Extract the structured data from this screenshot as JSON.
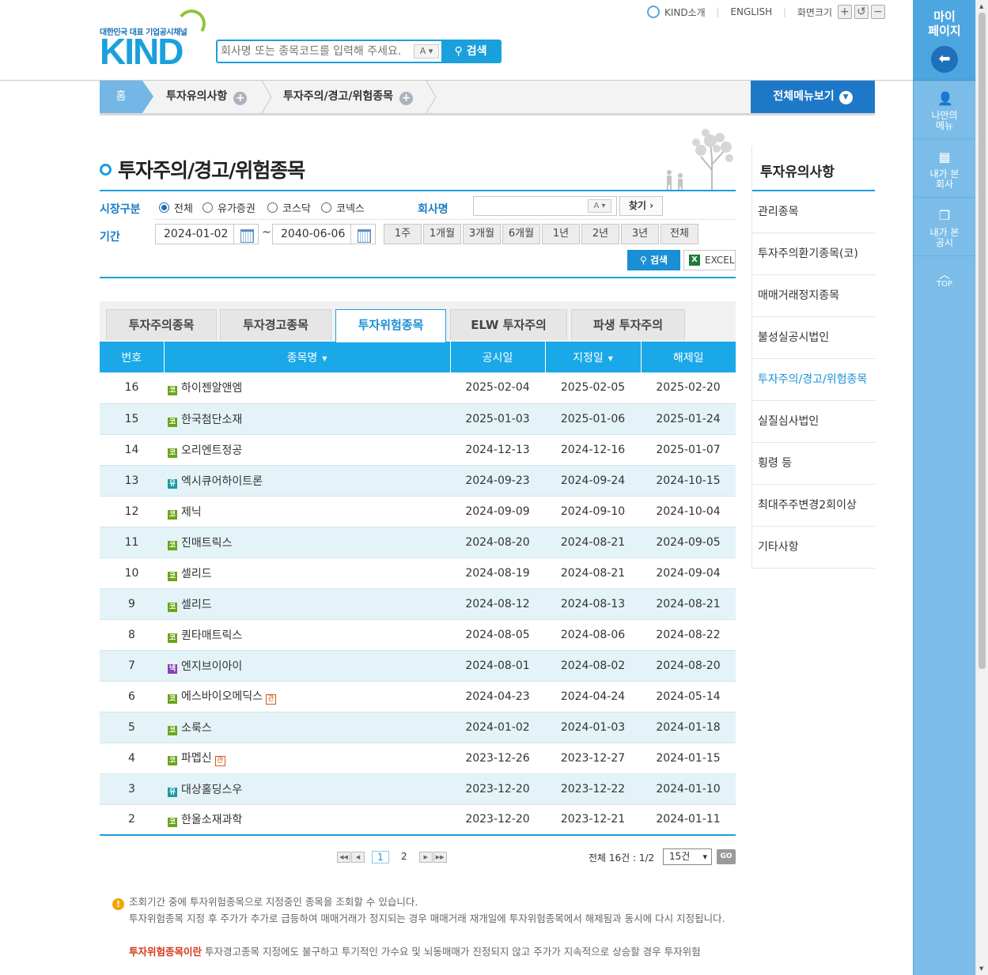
{
  "header": {
    "logo_tagline": "대한민국 대표 기업공시채널",
    "logo_text": "KIND",
    "search_placeholder": "회사명 또는 종목코드를 입력해 주세요.",
    "search_autocomplete": "A",
    "search_button": "검색",
    "links": {
      "about": "KIND소개",
      "english": "ENGLISH",
      "screen_size": "화면크기"
    }
  },
  "breadcrumb": {
    "home": "홈",
    "level1": "투자유의사항",
    "level2": "투자주의/경고/위험종목",
    "all_menu": "전체메뉴보기"
  },
  "page_title": "투자주의/경고/위험종목",
  "form": {
    "market_label": "시장구분",
    "markets": [
      "전체",
      "유가증권",
      "코스닥",
      "코넥스"
    ],
    "selected_market": "전체",
    "company_label": "회사명",
    "company_value": "",
    "company_ac": "A",
    "find_button": "찾기",
    "period_label": "기간",
    "date_from": "2024-01-02",
    "date_sep": "~",
    "date_to": "2040-06-06",
    "periods": [
      "1주",
      "1개월",
      "3개월",
      "6개월",
      "1년",
      "2년",
      "3년",
      "전체"
    ],
    "search_button": "검색",
    "excel_button": "EXCEL"
  },
  "tabs": [
    "투자주의종목",
    "투자경고종목",
    "투자위험종목",
    "ELW 투자주의",
    "파생 투자주의"
  ],
  "active_tab": "투자위험종목",
  "table": {
    "headers": [
      "번호",
      "종목명",
      "공시일",
      "지정일",
      "해제일"
    ],
    "rows": [
      {
        "no": "16",
        "market": "코",
        "name": "하이젠알앤엠",
        "badge": "",
        "notice": "2025-02-04",
        "designated": "2025-02-05",
        "released": "2025-02-20"
      },
      {
        "no": "15",
        "market": "코",
        "name": "한국첨단소재",
        "badge": "",
        "notice": "2025-01-03",
        "designated": "2025-01-06",
        "released": "2025-01-24"
      },
      {
        "no": "14",
        "market": "코",
        "name": "오리엔트정공",
        "badge": "",
        "notice": "2024-12-13",
        "designated": "2024-12-16",
        "released": "2025-01-07"
      },
      {
        "no": "13",
        "market": "유",
        "name": "엑시큐어하이트론",
        "badge": "",
        "notice": "2024-09-23",
        "designated": "2024-09-24",
        "released": "2024-10-15"
      },
      {
        "no": "12",
        "market": "코",
        "name": "제닉",
        "badge": "",
        "notice": "2024-09-09",
        "designated": "2024-09-10",
        "released": "2024-10-04"
      },
      {
        "no": "11",
        "market": "코",
        "name": "진매트릭스",
        "badge": "",
        "notice": "2024-08-20",
        "designated": "2024-08-21",
        "released": "2024-09-05"
      },
      {
        "no": "10",
        "market": "코",
        "name": "셀리드",
        "badge": "",
        "notice": "2024-08-19",
        "designated": "2024-08-21",
        "released": "2024-09-04"
      },
      {
        "no": "9",
        "market": "코",
        "name": "셀리드",
        "badge": "",
        "notice": "2024-08-12",
        "designated": "2024-08-13",
        "released": "2024-08-21"
      },
      {
        "no": "8",
        "market": "코",
        "name": "퀀타매트릭스",
        "badge": "",
        "notice": "2024-08-05",
        "designated": "2024-08-06",
        "released": "2024-08-22"
      },
      {
        "no": "7",
        "market": "넥",
        "name": "엔지브이아이",
        "badge": "",
        "notice": "2024-08-01",
        "designated": "2024-08-02",
        "released": "2024-08-20"
      },
      {
        "no": "6",
        "market": "코",
        "name": "에스바이오메딕스",
        "badge": "관",
        "notice": "2024-04-23",
        "designated": "2024-04-24",
        "released": "2024-05-14"
      },
      {
        "no": "5",
        "market": "코",
        "name": "소룩스",
        "badge": "",
        "notice": "2024-01-02",
        "designated": "2024-01-03",
        "released": "2024-01-18"
      },
      {
        "no": "4",
        "market": "코",
        "name": "파멥신",
        "badge": "관",
        "notice": "2023-12-26",
        "designated": "2023-12-27",
        "released": "2024-01-15"
      },
      {
        "no": "3",
        "market": "유",
        "name": "대상홀딩스우",
        "badge": "",
        "notice": "2023-12-20",
        "designated": "2023-12-22",
        "released": "2024-01-10"
      },
      {
        "no": "2",
        "market": "코",
        "name": "한울소재과학",
        "badge": "",
        "notice": "2023-12-20",
        "designated": "2023-12-21",
        "released": "2024-01-11"
      }
    ]
  },
  "pagination": {
    "pages": [
      "1",
      "2"
    ],
    "current": "1",
    "total": "전체 16건 : 1/2",
    "page_size": "15건",
    "go": "GO"
  },
  "notes": {
    "line1": "조회기간 중에 투자위험종목으로 지정중인 종목을 조회할 수 있습니다.",
    "line2": "투자위험종목 지정 후 주가가 추가로 급등하여 매매거래가 정지되는 경우 매매거래 재개일에 투자위험종목에서 해제됨과 동시에 다시 지정됩니다.",
    "def_term": "투자위험종목이란",
    "def_text": "투자경고종목 지정에도 불구하고 투기적인 가수요 및 뇌동매매가 진정되지 않고 주가가 지속적으로 상승할 경우 투자위험"
  },
  "side_menu": {
    "title": "투자유의사항",
    "items": [
      "관리종목",
      "투자주의환기종목(코)",
      "매매거래정지종목",
      "불성실공시법인",
      "투자주의/경고/위험종목",
      "실질심사법인",
      "횡령 등",
      "최대주주변경2회이상",
      "기타사항"
    ],
    "active": "투자주의/경고/위험종목"
  },
  "quick_bar": {
    "my_page": "마이\n페이지",
    "my_menu": "나만의\n메뉴",
    "viewed_company": "내가 본\n회사",
    "viewed_disclosure": "내가 본\n공시",
    "top": "TOP"
  },
  "colors": {
    "accent": "#1aa0dd",
    "header_row": "#1aa8e8",
    "alt_row": "#e4f3f8",
    "quickbar": "#7bbde8"
  }
}
